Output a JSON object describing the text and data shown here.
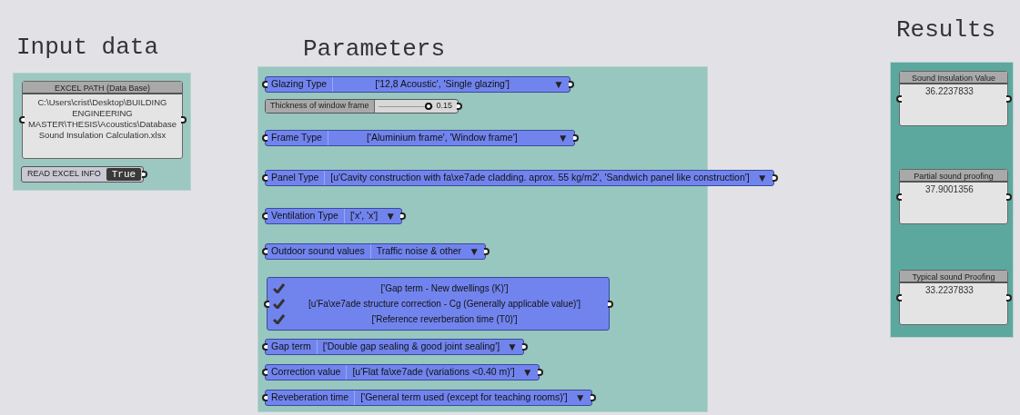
{
  "groups": [
    {
      "kind": "input",
      "title": "Input data"
    },
    {
      "kind": "parameters",
      "title": "Parameters"
    },
    {
      "kind": "results",
      "title": "Results"
    }
  ],
  "excel_panel": {
    "title": "EXCEL PATH (Data Base)",
    "text": "C:\\Users\\crist\\Desktop\\BUILDING ENGINEERING MASTER\\THESIS\\Acoustics\\Database Sound Insulation Calculation.xlsx"
  },
  "toggle": {
    "label": "READ EXCEL INFO",
    "value": "True",
    "on": true
  },
  "parameters": [
    {
      "kind": "value_list",
      "label": "Glazing Type",
      "value": "['12,8 Acoustic', 'Single glazing']",
      "caret": "▼"
    },
    {
      "kind": "slider",
      "label": "Thickness of window frame",
      "value": "0.15",
      "level": 0.92
    },
    {
      "kind": "value_list",
      "label": "Frame Type",
      "value": "['Aluminium frame', 'Window frame']",
      "caret": "▼"
    },
    {
      "kind": "value_list",
      "label": "Panel Type",
      "value": "[u'Cavity construction with fa\\xe7ade cladding. aprox. 55 kg/m2', 'Sandwich panel like construction']",
      "caret": "▼"
    },
    {
      "kind": "value_list",
      "label": "Ventilation Type",
      "value": "['x', 'x']",
      "caret": "▼"
    },
    {
      "kind": "value_list",
      "label": "Outdoor sound values",
      "value": "Traffic noise & other",
      "caret": "▼"
    },
    {
      "kind": "checklist",
      "items": [
        {
          "text": "['Gap term - New dwellings (K)']",
          "checked": true
        },
        {
          "text": "[u'Fa\\xe7ade structure correction - Cg (Generally applicable value)']",
          "checked": true
        },
        {
          "text": "['Reference reverberation time (T0)']",
          "checked": true
        }
      ]
    },
    {
      "kind": "value_list",
      "label": "Gap term",
      "value": "['Double gap sealing & good joint sealing']",
      "caret": "▼"
    },
    {
      "kind": "value_list",
      "label": "Correction value",
      "value": "[u'Flat fa\\xe7ade (variations <0.40 m)']",
      "caret": "▼"
    },
    {
      "kind": "value_list",
      "label": "Reveberation time",
      "value": "['General term used (except for teaching rooms)']",
      "caret": "▼"
    }
  ],
  "results": [
    {
      "title": "Sound Insulation Value",
      "value": "36.2237833"
    },
    {
      "title": "Partial sound proofing",
      "value": "37.9001356"
    },
    {
      "title": "Typical sound Proofing",
      "value": "33.2237833"
    }
  ]
}
